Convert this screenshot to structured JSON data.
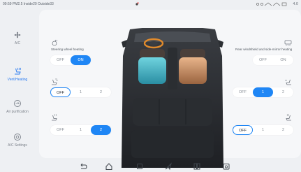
{
  "status": {
    "time": "09:59",
    "pm25": "PM2.5 Inside20 Outside33",
    "signal": "4.0"
  },
  "sidebar": {
    "items": [
      {
        "label": "A/C",
        "icon": "fan-icon",
        "active": false
      },
      {
        "label": "Vent/Heating",
        "icon": "seat-heating-icon",
        "active": true
      },
      {
        "label": "Air purification",
        "icon": "air-purification-icon",
        "active": false
      },
      {
        "label": "A/C Settings",
        "icon": "settings-icon",
        "active": false
      }
    ]
  },
  "steering": {
    "label": "Steering wheel heating",
    "options": [
      "OFF",
      "ON"
    ],
    "selected": 1
  },
  "windshield": {
    "label": "Rear windshield and side-mirror heating",
    "options": [
      "OFF",
      "ON"
    ],
    "selected": 0
  },
  "driver_vent": {
    "options": [
      "OFF",
      "1",
      "2"
    ],
    "selected": 0
  },
  "passenger_vent": {
    "options": [
      "OFF",
      "1",
      "2"
    ],
    "selected": 1
  },
  "driver_heat": {
    "options": [
      "OFF",
      "1",
      "2"
    ],
    "selected": 2
  },
  "passenger_heat": {
    "options": [
      "OFF",
      "1",
      "2"
    ],
    "selected": 0
  },
  "colors": {
    "accent": "#1f86f5",
    "seat_vent": "#3bb6c9",
    "seat_heat": "#c98a5e"
  }
}
